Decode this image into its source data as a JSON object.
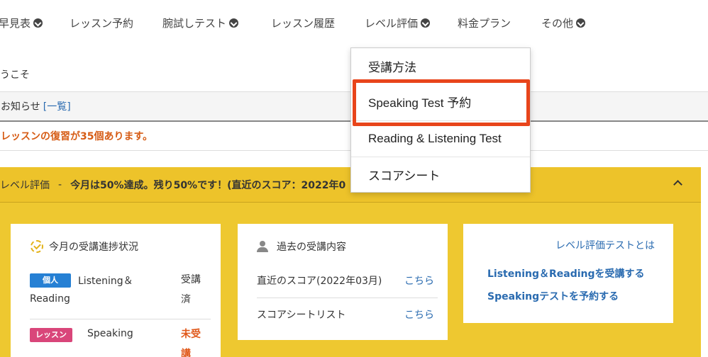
{
  "nav": {
    "items": [
      {
        "label": "早見表",
        "has_caret": true
      },
      {
        "label": "レッスン予約",
        "has_caret": false
      },
      {
        "label": "腕試しテスト",
        "has_caret": true
      },
      {
        "label": "レッスン履歴",
        "has_caret": false
      },
      {
        "label": "レベル評価",
        "has_caret": true
      },
      {
        "label": "料金プラン",
        "has_caret": false
      },
      {
        "label": "その他",
        "has_caret": true
      }
    ]
  },
  "welcome": "うこそ",
  "notice": {
    "title": "お知らせ",
    "list_link": "[一覧]",
    "message": "レッスンの復習が35個あります。"
  },
  "level": {
    "header_label": "レベル評価",
    "separator": "-",
    "summary": "今月は50%達成。残り50%です！(直近のスコア：2022年0"
  },
  "progress_card": {
    "title": "今月の受講進捗状況",
    "rows": [
      {
        "badge": "個人",
        "name_line1": "Listening＆",
        "name_line2": "Reading",
        "status": "受講済"
      },
      {
        "badge": "レッスン",
        "name_line1": "Speaking",
        "name_line2": "",
        "status": "未受講"
      }
    ]
  },
  "history_card": {
    "title": "過去の受講内容",
    "rows": [
      {
        "label": "直近のスコア(2022年03月)",
        "link": "こちら"
      },
      {
        "label": "スコアシートリスト",
        "link": "こちら"
      }
    ]
  },
  "links_card": {
    "about": "レベル評価テストとは",
    "listening_reading": "Listening＆Readingを受講する",
    "speaking": "Speakingテストを予約する"
  },
  "dropdown": {
    "items": [
      "受講方法",
      "Speaking Test 予約",
      "Reading & Listening Test",
      "スコアシート"
    ]
  },
  "colors": {
    "accent_gold": "#eec830",
    "link_blue": "#2a6bb0",
    "badge_blue": "#2680d4",
    "badge_pink": "#d9467a",
    "highlight_red": "#e8451b",
    "warning_orange": "#d65c15"
  }
}
